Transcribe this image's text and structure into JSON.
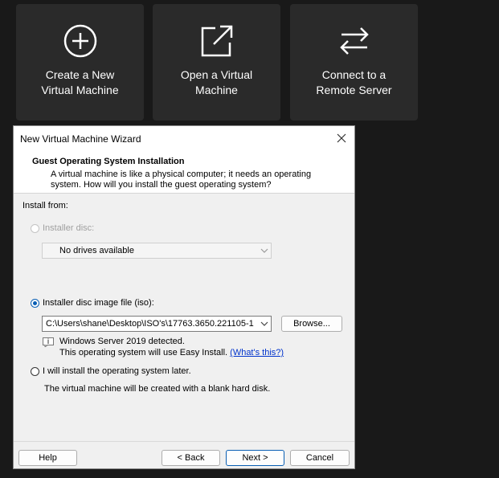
{
  "tiles": [
    {
      "line1": "Create a New",
      "line2": "Virtual Machine",
      "icon": "plus-circle-icon"
    },
    {
      "line1": "Open a Virtual",
      "line2": "Machine",
      "icon": "open-external-icon"
    },
    {
      "line1": "Connect to a",
      "line2": "Remote Server",
      "icon": "swap-arrows-icon"
    }
  ],
  "dialog": {
    "title": "New Virtual Machine Wizard",
    "header_title": "Guest Operating System Installation",
    "header_desc": "A virtual machine is like a physical computer; it needs an operating system. How will you install the guest operating system?",
    "install_from": "Install from:",
    "installer_disc_label": "Installer disc:",
    "drives_value": "No drives available",
    "iso_label": "Installer disc image file (iso):",
    "iso_path": "C:\\Users\\shane\\Desktop\\ISO's\\17763.3650.221105-1",
    "browse": "Browse...",
    "detected_line1": "Windows Server 2019 detected.",
    "detected_line2": "This operating system will use Easy Install.",
    "whats_this": "(What's this?)",
    "later_label": "I will install the operating system later.",
    "later_desc": "The virtual machine will be created with a blank hard disk.",
    "help": "Help",
    "back": "< Back",
    "next": "Next >",
    "cancel": "Cancel",
    "selected_option": "iso"
  },
  "colors": {
    "background": "#191919",
    "tile": "#2a2a2a",
    "accent": "#0a5fb4"
  }
}
